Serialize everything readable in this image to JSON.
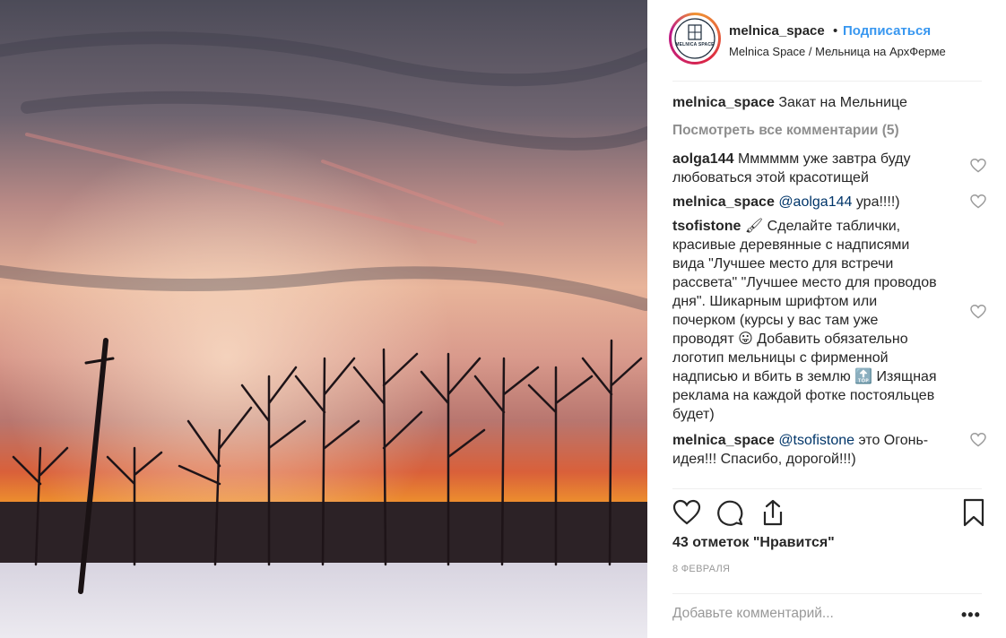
{
  "header": {
    "username": "melnica_space",
    "separator": "•",
    "follow_label": "Подписаться",
    "location": "Melnica Space / Мельница на АрхФерме",
    "avatar_text": "MELNICA SPACE"
  },
  "caption": {
    "username": "melnica_space",
    "text": "Закат на Мельнице"
  },
  "view_all_comments": "Посмотреть все комментарии (5)",
  "comments": [
    {
      "username": "aolga144",
      "text_lines": [
        "Мммммм уже завтра буду",
        "любоваться этой красотищей"
      ]
    },
    {
      "username": "melnica_space",
      "mention": "@aolga144",
      "text": "ура!!!!)"
    },
    {
      "username": "tsofistone",
      "emoji_1": "🖌",
      "text_1": "Сделайте таблички,",
      "lines": [
        "красивые деревянные с надписями",
        "вида \"Лучшее место для встречи",
        "рассвета\" \"Лучшее место для проводов",
        "дня\". Шикарным шрифтом или",
        "почерком (курсы у вас там уже"
      ],
      "line_with_emoji_pre": "проводят",
      "emoji_2": "😛",
      "line_with_emoji_post": "Добавить обязательно",
      "lines_2": [
        "логотип мельницы с фирменной"
      ],
      "line_top_pre": "надписью и вбить в землю",
      "emoji_3": "🔝",
      "line_top_post": "Изящная",
      "lines_3": [
        "реклама на каждой фотке постояльцев",
        "будет)"
      ]
    },
    {
      "username": "melnica_space",
      "mention": "@tsofistone",
      "text_1": "это Огонь-",
      "text_2": "идея!!! Спасибо, дорогой!!!)"
    }
  ],
  "likes": "43 отметок \"Нравится\"",
  "date": "8 ФЕВРАЛЯ",
  "add_comment_placeholder": "Добавьте комментарий...",
  "more_label": "•••",
  "icons": [
    "heart-icon",
    "comment-icon",
    "share-icon",
    "bookmark-icon",
    "more-icon"
  ]
}
